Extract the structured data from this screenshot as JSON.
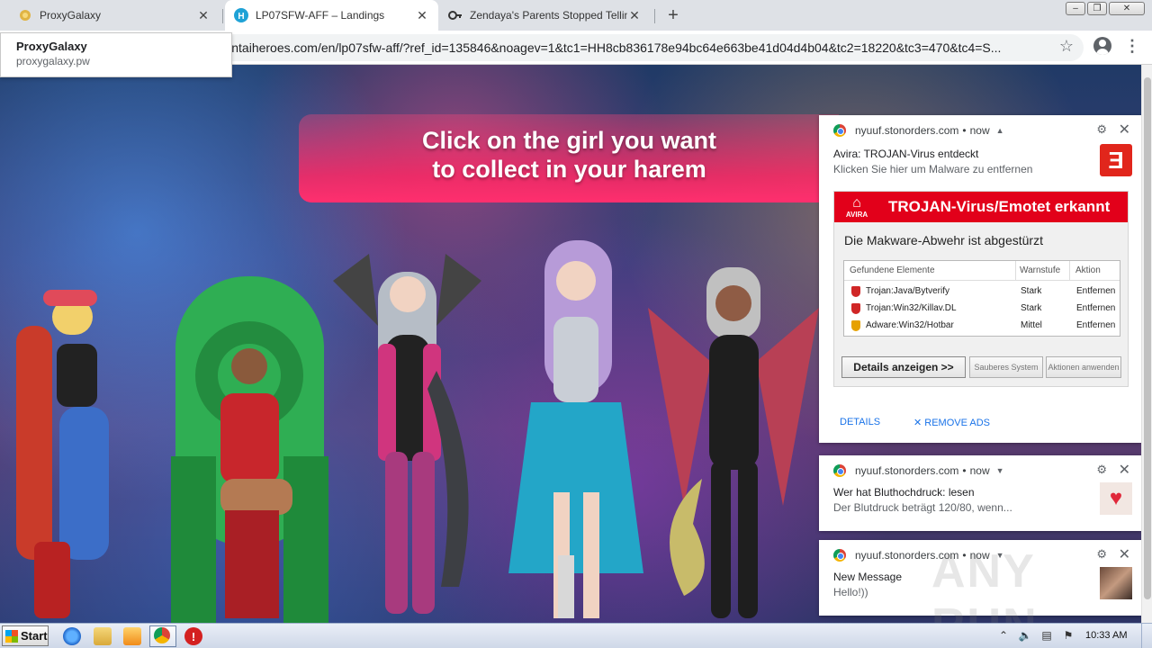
{
  "tabs": [
    {
      "title": "ProxyGalaxy",
      "active": false
    },
    {
      "title": "LP07SFW-AFF – Landings",
      "active": true
    },
    {
      "title": "Zendaya's Parents Stopped Telling H",
      "active": false
    }
  ],
  "tooltip": {
    "title": "ProxyGalaxy",
    "url": "proxygalaxy.pw"
  },
  "omnibox": {
    "url": "g.hentaiheroes.com/en/lp07sfw-aff/?ref_id=135846&noagev=1&tc1=HH8cb836178e94bc64e663be41d04d4b04&tc2=18220&tc3=470&tc4=S..."
  },
  "page": {
    "banner_line1": "Click on the girl you want",
    "banner_line2": "to collect in your harem",
    "prev_arrow": "‹"
  },
  "notifications": [
    {
      "source": "nyuuf.stonorders.com",
      "time": "now",
      "title": "Avira: TROJAN-Virus entdeckt",
      "body": "Klicken Sie hier um Malware zu entfernen",
      "image": {
        "logo_text": "AVIRA",
        "heading": "TROJAN-Virus/Emotet erkannt",
        "subheading": "Die Makware-Abwehr ist abgestürzt",
        "columns": [
          "Gefundene Elemente",
          "Warnstufe",
          "Aktion"
        ],
        "rows": [
          {
            "item": "Trojan:Java/Bytverify",
            "level": "Stark",
            "action": "Entfernen"
          },
          {
            "item": "Trojan:Win32/Killav.DL",
            "level": "Stark",
            "action": "Entfernen"
          },
          {
            "item": "Adware:Win32/Hotbar",
            "level": "Mittel",
            "action": "Entfernen"
          }
        ],
        "btn_details": "Details anzeigen >>",
        "btn_clean": "Sauberes System",
        "btn_apply": "Aktionen anwenden"
      },
      "action_details": "DETAILS",
      "action_remove": "REMOVE ADS"
    },
    {
      "source": "nyuuf.stonorders.com",
      "time": "now",
      "title": "Wer hat Bluthochdruck: lesen",
      "body": "Der Blutdruck beträgt 120/80, wenn..."
    },
    {
      "source": "nyuuf.stonorders.com",
      "time": "now",
      "title": "New Message",
      "body": "Hello!))"
    }
  ],
  "watermark": "ANY RUN",
  "taskbar": {
    "start_label": "Start",
    "clock": "10:33 AM"
  },
  "colors": {
    "accent_red": "#e2001a",
    "banner_pink": "#ff2f6e",
    "link_blue": "#1a73e8"
  }
}
